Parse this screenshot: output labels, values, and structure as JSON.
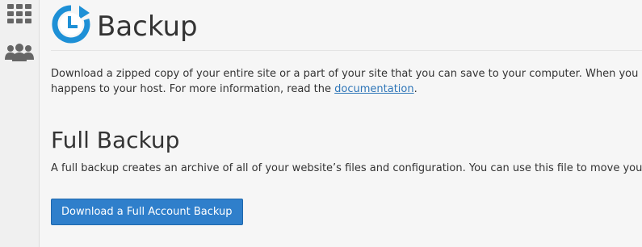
{
  "sidebar": {
    "items": [
      {
        "icon": "grid-icon",
        "label": ""
      },
      {
        "icon": "users-icon",
        "label": ""
      }
    ]
  },
  "header": {
    "title": "Backup",
    "icon": "backup-clock-icon",
    "icon_color": "#1e90d6"
  },
  "intro": {
    "line1": "Download a zipped copy of your entire site or a part of your site that you can save to your computer. When you ba",
    "line2_prefix": "happens to your host. For more information, read the ",
    "doc_link": "documentation",
    "line2_suffix": "."
  },
  "full_backup": {
    "title": "Full Backup",
    "description": "A full backup creates an archive of all of your website’s files and configuration. You can use this file to move your a",
    "button_label": "Download a Full Account Backup"
  },
  "colors": {
    "accent": "#2f7fcb",
    "link": "#2f76b8",
    "sidebar_icon": "#666666"
  }
}
